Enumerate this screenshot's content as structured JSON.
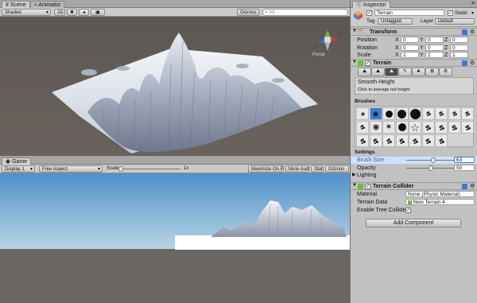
{
  "scene": {
    "tab_label": "Scene",
    "tab2_label": "Animator",
    "shading": "Shaded",
    "mode_2d": "2D",
    "gizmos": "Gizmos",
    "search_placeholder": "All",
    "persp_label": "Persp"
  },
  "game": {
    "tab_label": "Game",
    "display": "Display 1",
    "aspect": "Free Aspect",
    "scale_label": "Scale",
    "scale_value": "1x",
    "maximize": "Maximize On Play",
    "mute": "Mute Audio",
    "stats": "Stats",
    "gizmos": "Gizmos"
  },
  "inspector": {
    "tab_label": "Inspector",
    "object_name": "Terrain",
    "static_label": "Static",
    "tag_label": "Tag",
    "tag_value": "Untagged",
    "layer_label": "Layer",
    "layer_value": "Default",
    "transform": {
      "title": "Transform",
      "rows": [
        {
          "label": "Position",
          "x": "0",
          "y": "0",
          "z": "0"
        },
        {
          "label": "Rotation",
          "x": "0",
          "y": "0",
          "z": "0"
        },
        {
          "label": "Scale",
          "x": "1",
          "y": "1",
          "z": "1"
        }
      ]
    },
    "terrain": {
      "title": "Terrain",
      "tool_title": "Smooth Height",
      "tool_desc": "Click to average out height.",
      "brushes_label": "Brushes",
      "settings_label": "Settings",
      "brush_size_label": "Brush Size",
      "brush_size_value": "63",
      "brush_size_level": 0.55,
      "opacity_label": "Opacity",
      "opacity_value": "50",
      "opacity_level": 0.5,
      "lighting_label": "Lighting"
    },
    "collider": {
      "title": "Terrain Collider",
      "material_label": "Material",
      "material_value": "None (Physic Material)",
      "data_label": "Terrain Data",
      "data_value": "New Terrain 4",
      "trees_label": "Enable Tree Colliders"
    },
    "add_component": "Add Component"
  },
  "axis_labels": {
    "x": "x",
    "y": "y",
    "z": "z"
  },
  "colors": {
    "accent": "#3a7bd5",
    "field_highlight": "#cfe0ff"
  }
}
